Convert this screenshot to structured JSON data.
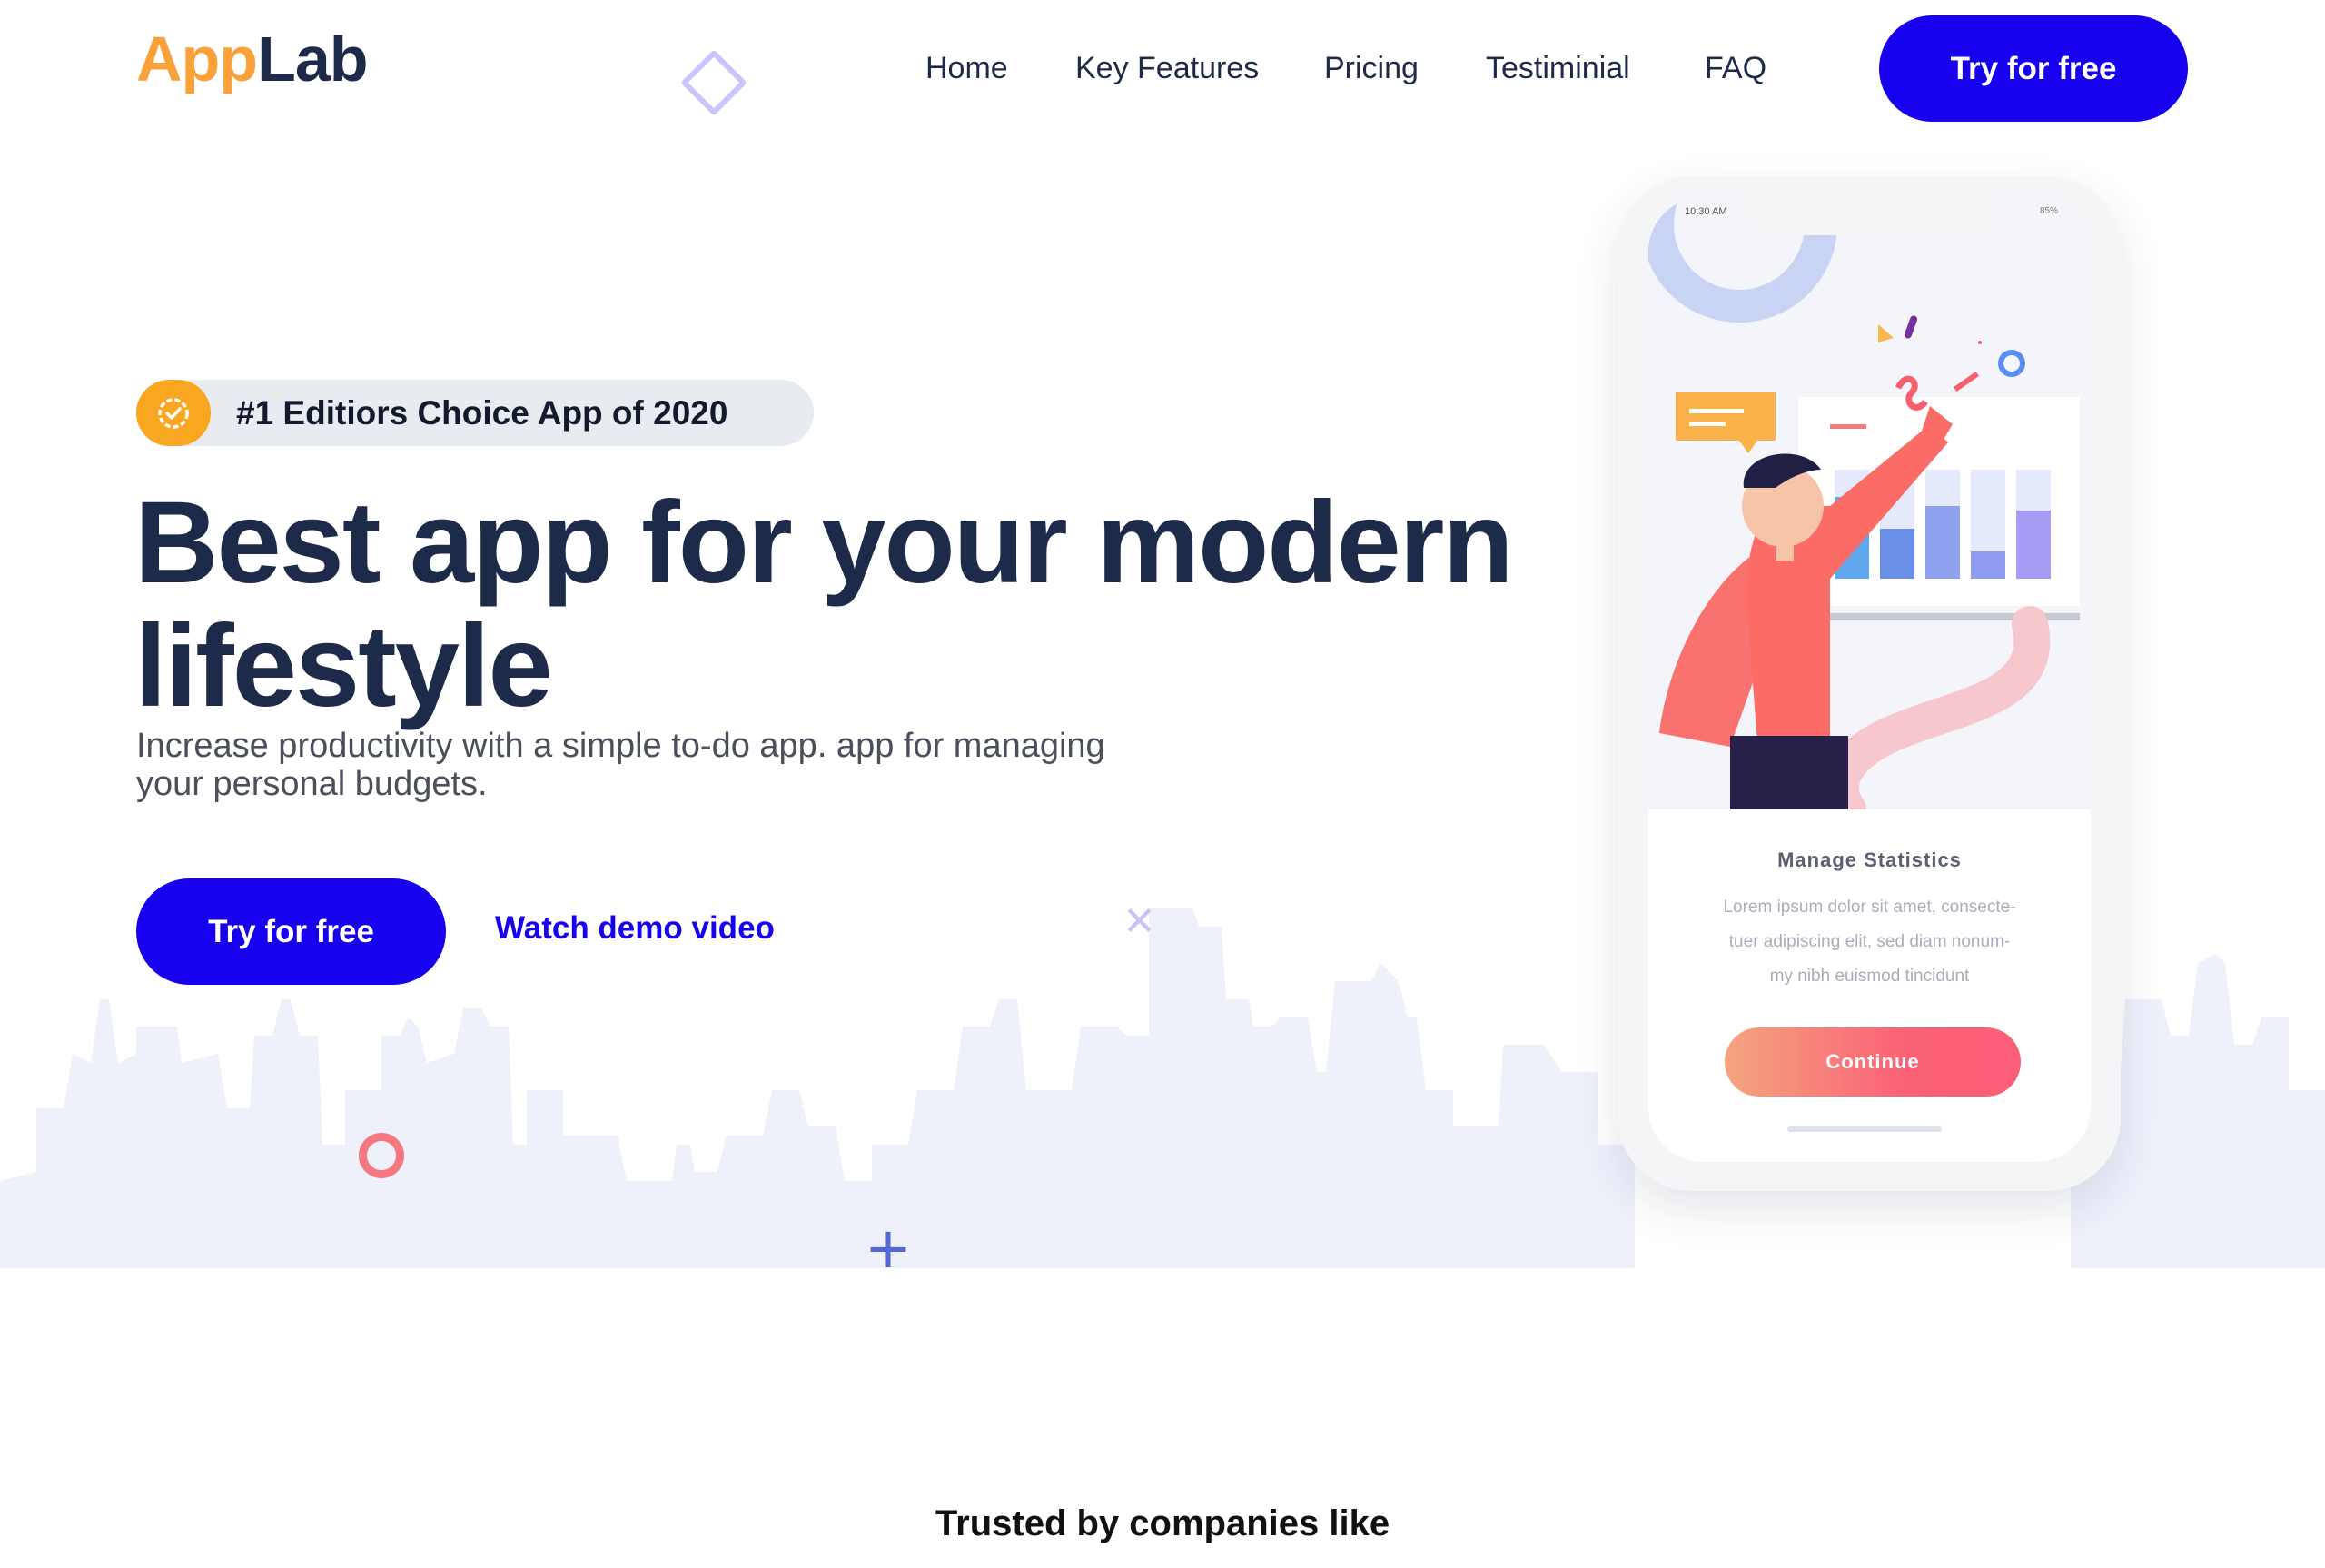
{
  "header": {
    "logo": {
      "app": "App",
      "lab": "Lab"
    },
    "nav": [
      "Home",
      "Key Features",
      "Pricing",
      "Testiminial",
      "FAQ"
    ],
    "cta_label": "Try for free"
  },
  "hero": {
    "badge": "#1 Editiors Choice App of 2020",
    "headline_line1": "Best app for your modern",
    "headline_line2": "lifestyle",
    "subtext_line1": "Increase productivity with a simple to-do app. app for managing",
    "subtext_line2": "your personal budgets.",
    "cta_label": "Try for free",
    "demo_label": "Watch demo video"
  },
  "phone": {
    "status_time": "10:30 AM",
    "status_battery": "85%",
    "card_title": "Manage Statistics",
    "card_body_line1": "Lorem ipsum dolor sit amet, consecte-",
    "card_body_line2": "tuer adipiscing elit, sed diam nonum-",
    "card_body_line3": "my nibh euismod tincidunt",
    "button_label": "Continue"
  },
  "trusted": {
    "title": "Trusted by companies like"
  },
  "colors": {
    "brand_blue": "#1600ee",
    "logo_orange": "#f9a23b",
    "navy_text": "#1e2a4a",
    "badge_orange": "#f9a621",
    "skyline": "#eef1fa",
    "continue_gradient_start": "#f3a57e",
    "continue_gradient_end": "#fc5e78"
  },
  "icons": [
    "check-badge-icon",
    "diamond-shape-icon",
    "ring-shape-icon",
    "plus-shape-icon",
    "cross-shape-icon"
  ]
}
